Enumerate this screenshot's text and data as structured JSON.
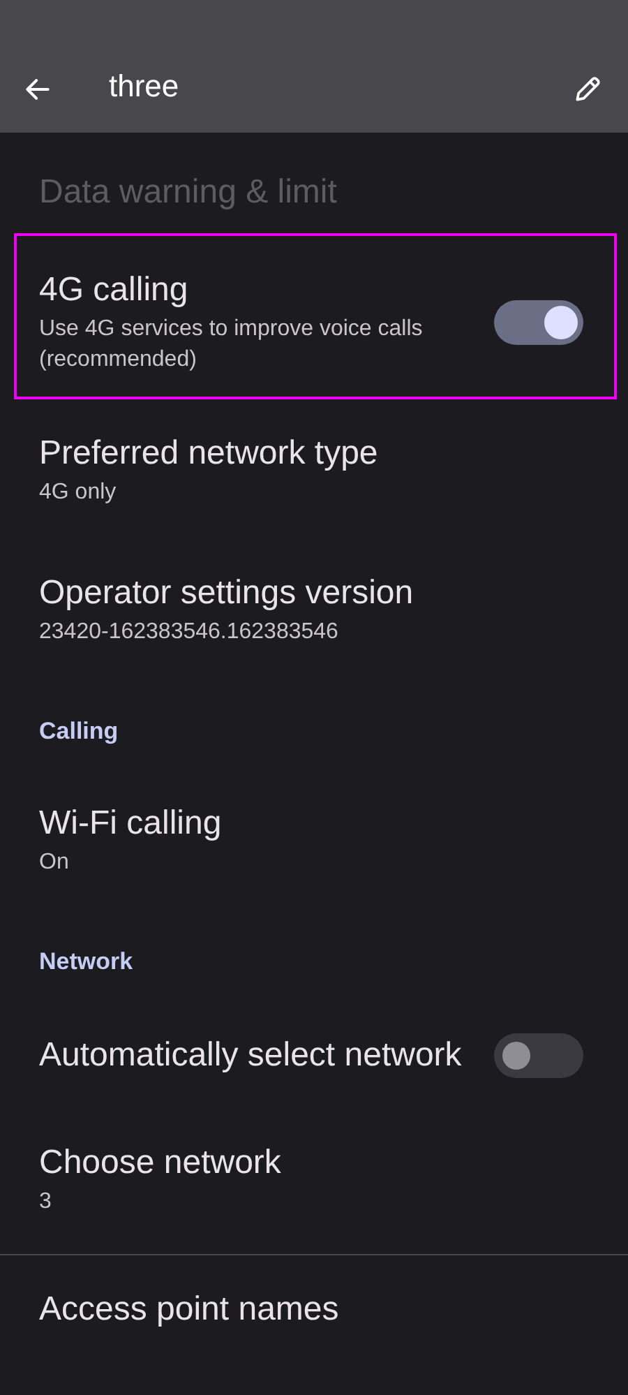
{
  "app_bar": {
    "title": "three"
  },
  "items": [
    {
      "kind": "setting",
      "title": "Data warning & limit",
      "disabled": true
    },
    {
      "kind": "setting",
      "title": "4G calling",
      "summary": "Use 4G services to improve voice calls (recommended)",
      "highlighted": true,
      "toggle": {
        "on": true
      }
    },
    {
      "kind": "setting",
      "title": "Preferred network type",
      "summary": "4G only"
    },
    {
      "kind": "setting",
      "title": "Operator settings version",
      "summary": "23420-162383546.162383546"
    },
    {
      "kind": "header",
      "title": "Calling"
    },
    {
      "kind": "setting",
      "title": "Wi-Fi calling",
      "summary": "On"
    },
    {
      "kind": "header",
      "title": "Network"
    },
    {
      "kind": "setting",
      "title": "Automatically select network",
      "toggle": {
        "on": false
      }
    },
    {
      "kind": "setting",
      "title": "Choose network",
      "summary": "3"
    },
    {
      "kind": "setting",
      "title": "Access point names",
      "divider_above": true
    }
  ]
}
